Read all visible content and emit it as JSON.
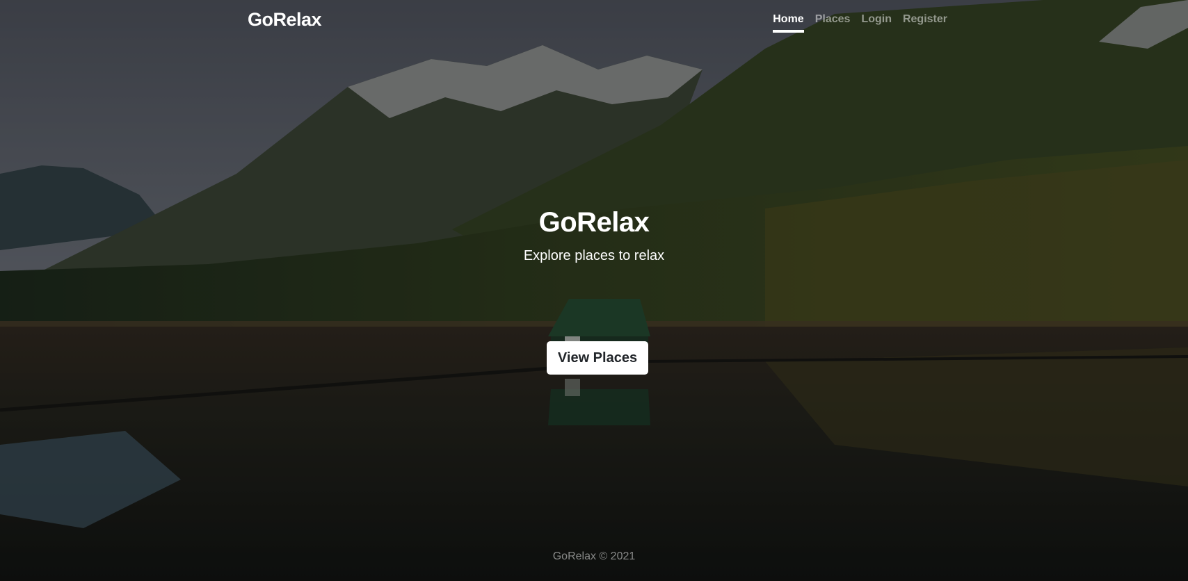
{
  "header": {
    "brand": "GoRelax",
    "nav": [
      {
        "label": "Home",
        "active": true
      },
      {
        "label": "Places",
        "active": false
      },
      {
        "label": "Login",
        "active": false
      },
      {
        "label": "Register",
        "active": false
      }
    ]
  },
  "hero": {
    "title": "GoRelax",
    "subtitle": "Explore places to relax",
    "cta_label": "View Places"
  },
  "footer": {
    "copyright": "GoRelax © 2021"
  },
  "colors": {
    "text": "#ffffff",
    "muted_nav": "#8f8f8f",
    "button_bg": "#ffffff",
    "button_text": "#212529"
  }
}
